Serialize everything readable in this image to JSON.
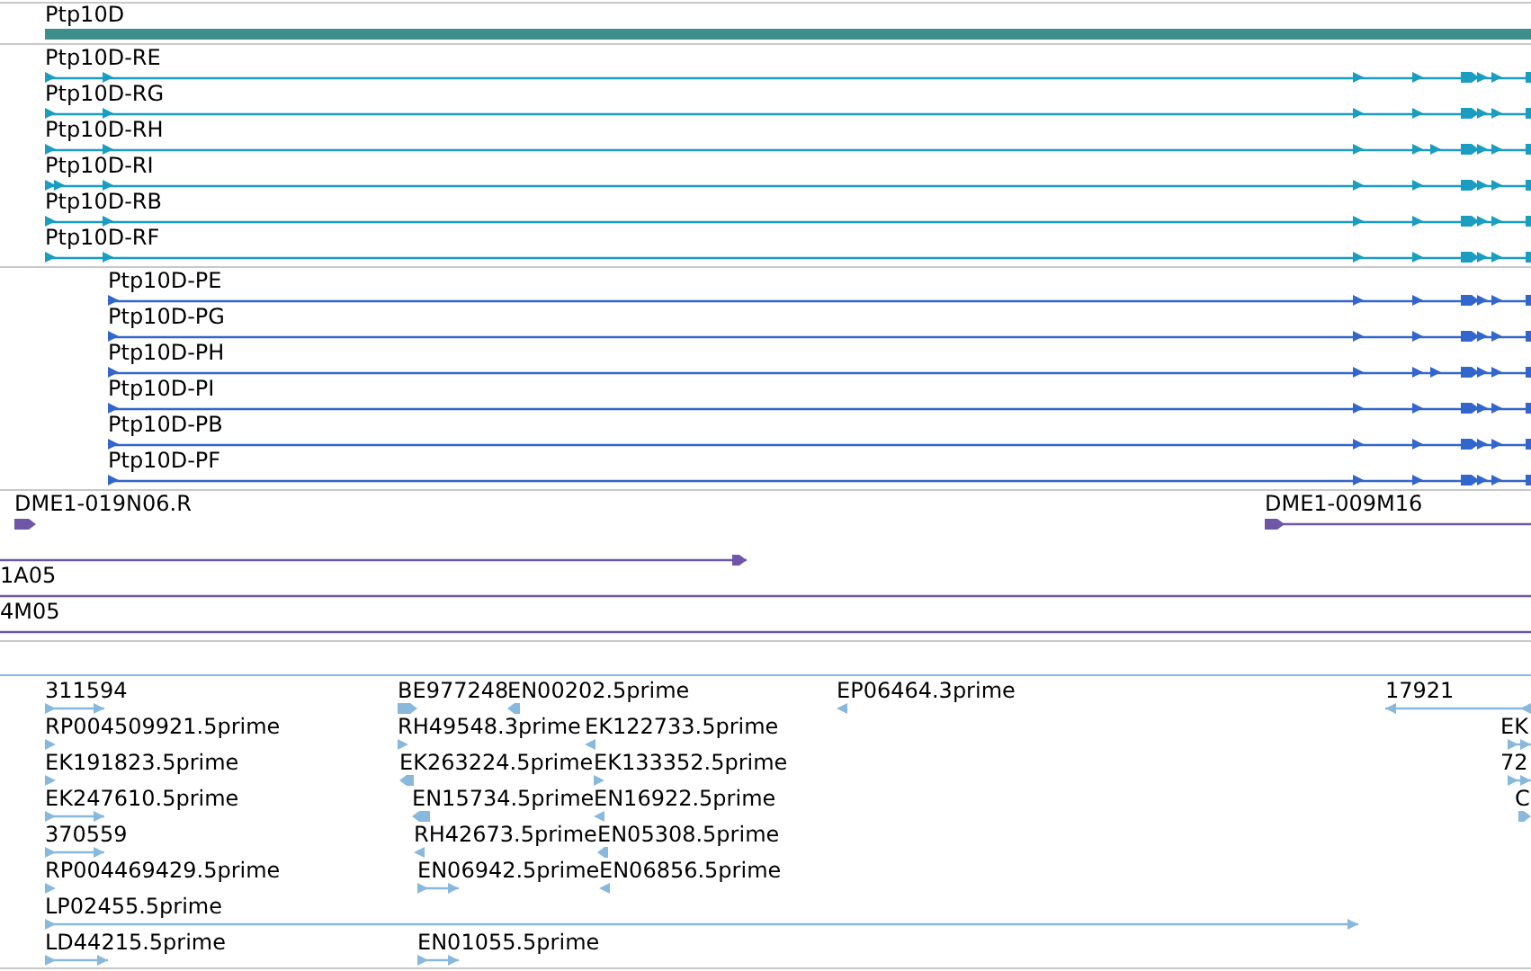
{
  "tracks": [
    {
      "kind": "gene",
      "features": [
        {
          "label": "Ptp10D"
        }
      ]
    },
    {
      "kind": "transcript",
      "features": [
        {
          "label": "Ptp10D-RE",
          "reverse": false
        },
        {
          "label": "Ptp10D-RG",
          "reverse": false
        },
        {
          "label": "Ptp10D-RH",
          "reverse": false
        },
        {
          "label": "Ptp10D-RI",
          "reverse": false
        },
        {
          "label": "Ptp10D-RB",
          "reverse": false
        },
        {
          "label": "Ptp10D-RF",
          "reverse": false
        }
      ]
    },
    {
      "kind": "protein",
      "features": [
        {
          "label": "Ptp10D-PE",
          "reverse": false
        },
        {
          "label": "Ptp10D-PG",
          "reverse": false
        },
        {
          "label": "Ptp10D-PH",
          "reverse": false
        },
        {
          "label": "Ptp10D-PI",
          "reverse": false
        },
        {
          "label": "Ptp10D-PB",
          "reverse": false
        },
        {
          "label": "Ptp10D-PF",
          "reverse": false
        }
      ]
    },
    {
      "kind": "clone",
      "features": [
        {
          "label": "DME1-019N06.R",
          "reverse": false
        },
        {
          "label": "DME1-009M16",
          "reverse": false
        },
        {
          "reverse": false
        },
        {
          "label": "1A05"
        },
        {
          "label": "4M05"
        }
      ]
    },
    {
      "kind": "est",
      "features": [
        {
          "label": "311594",
          "reverse": false
        },
        {
          "label": "BE977248",
          "reverse": false
        },
        {
          "label": "EN00202.5prime",
          "reverse": true
        },
        {
          "label": "EP06464.3prime",
          "reverse": true
        },
        {
          "label": "17921",
          "reverse": true
        },
        {
          "label": "RP004509921.5prime",
          "reverse": false
        },
        {
          "label": "RH49548.3prime",
          "reverse": false
        },
        {
          "label": "EK122733.5prime",
          "reverse": true
        },
        {
          "label": "EK",
          "reverse": false
        },
        {
          "label": "EK191823.5prime",
          "reverse": false
        },
        {
          "label": "EK263224.5prime",
          "reverse": true
        },
        {
          "label": "EK133352.5prime",
          "reverse": false
        },
        {
          "label": "72",
          "reverse": false
        },
        {
          "label": "EK247610.5prime",
          "reverse": false
        },
        {
          "label": "EN15734.5prime",
          "reverse": true
        },
        {
          "label": "EN16922.5prime",
          "reverse": true
        },
        {
          "label": "C",
          "reverse": false
        },
        {
          "label": "370559",
          "reverse": false
        },
        {
          "label": "RH42673.5prime",
          "reverse": true
        },
        {
          "label": "EN05308.5prime",
          "reverse": true
        },
        {
          "label": "RP004469429.5prime",
          "reverse": false
        },
        {
          "label": "EN06942.5prime",
          "reverse": false
        },
        {
          "label": "EN06856.5prime",
          "reverse": true
        },
        {
          "label": "LP02455.5prime",
          "reverse": false
        },
        {
          "label": "LD44215.5prime",
          "reverse": false
        },
        {
          "label": "EN01055.5prime",
          "reverse": false
        }
      ]
    }
  ]
}
